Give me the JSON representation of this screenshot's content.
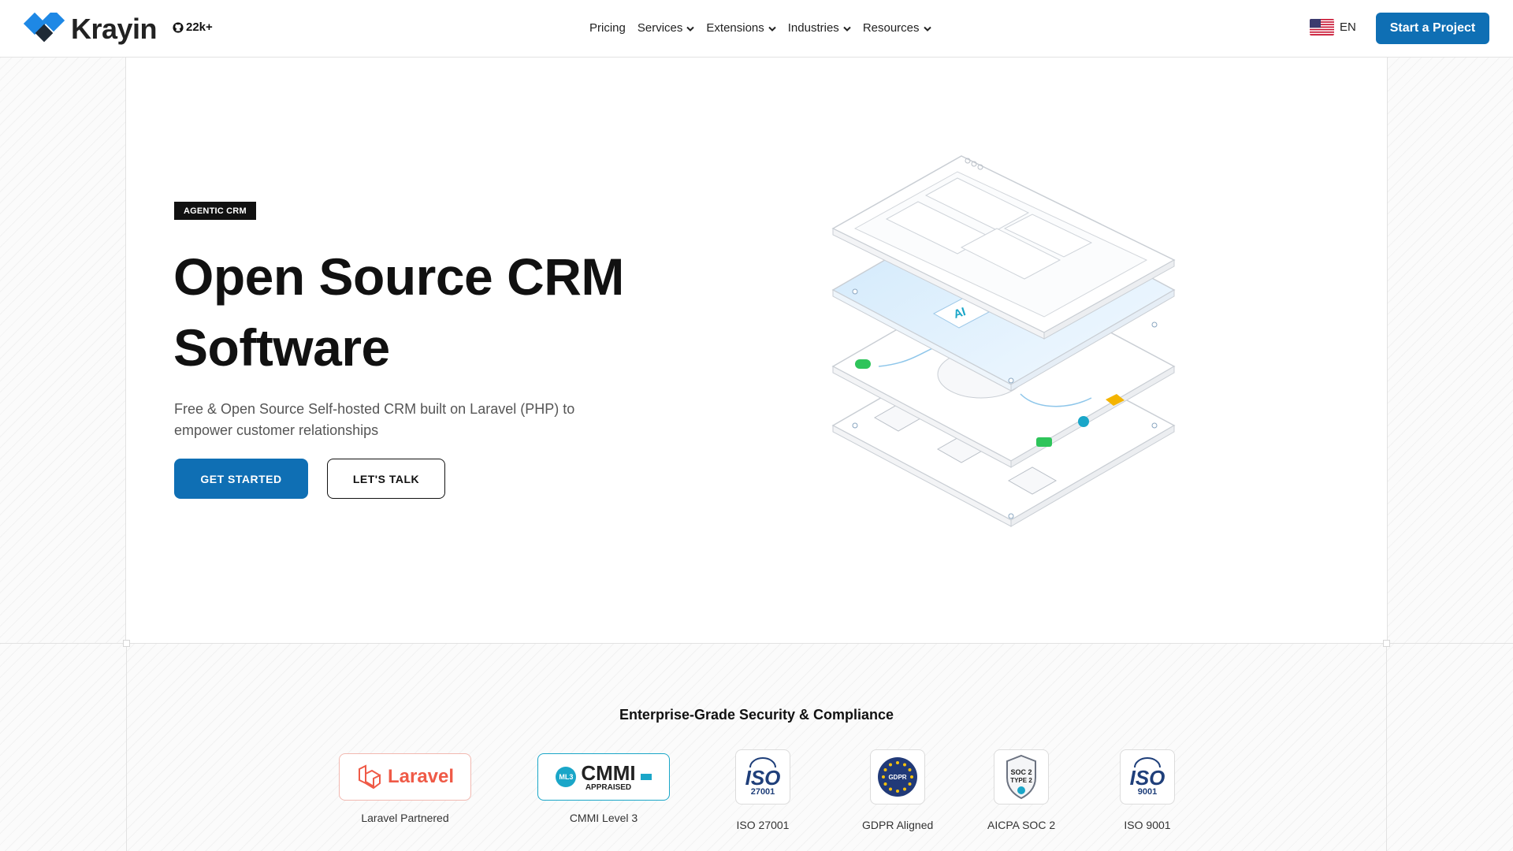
{
  "header": {
    "brand": "Krayin",
    "github_stars": "22k+",
    "nav": [
      {
        "label": "Pricing",
        "has_menu": false
      },
      {
        "label": "Services",
        "has_menu": true
      },
      {
        "label": "Extensions",
        "has_menu": true
      },
      {
        "label": "Industries",
        "has_menu": true
      },
      {
        "label": "Resources",
        "has_menu": true
      }
    ],
    "language": "EN",
    "cta_label": "Start a Project"
  },
  "hero": {
    "badge": "AGENTIC CRM",
    "title_line1": "Open Source CRM",
    "title_line2": "Software",
    "subtitle": "Free & Open Source Self-hosted CRM built on Laravel (PHP) to empower customer relationships",
    "primary_button": "GET STARTED",
    "secondary_button": "LET'S TALK",
    "illustration_chip": "AI"
  },
  "compliance": {
    "title": "Enterprise-Grade Security & Compliance",
    "certs": [
      {
        "label": "Laravel Partnered",
        "logo_text": "Laravel",
        "icon": "laravel-logo"
      },
      {
        "label": "CMMI Level 3",
        "logo_text": "CMMI",
        "logo_sub": "APPRAISED",
        "logo_badge": "ML3",
        "icon": "cmmi-logo"
      },
      {
        "label": "ISO 27001",
        "logo_text": "ISO",
        "logo_sub": "27001",
        "icon": "iso-globe-icon"
      },
      {
        "label": "GDPR Aligned",
        "logo_text": "GDPR",
        "icon": "gdpr-eu-stars-icon"
      },
      {
        "label": "AICPA SOC 2",
        "logo_text": "SOC 2",
        "logo_sub": "TYPE 2",
        "icon": "soc2-shield-icon"
      },
      {
        "label": "ISO 9001",
        "logo_text": "ISO",
        "logo_sub": "9001",
        "icon": "iso-globe-icon"
      }
    ]
  },
  "colors": {
    "brand_blue": "#0f6fb4",
    "logo_blue": "#1e88e5",
    "logo_dark": "#1f2a36",
    "laravel_red": "#ef5a47",
    "cmmi_teal": "#1aa6c8",
    "gdpr_navy": "#213a78"
  }
}
